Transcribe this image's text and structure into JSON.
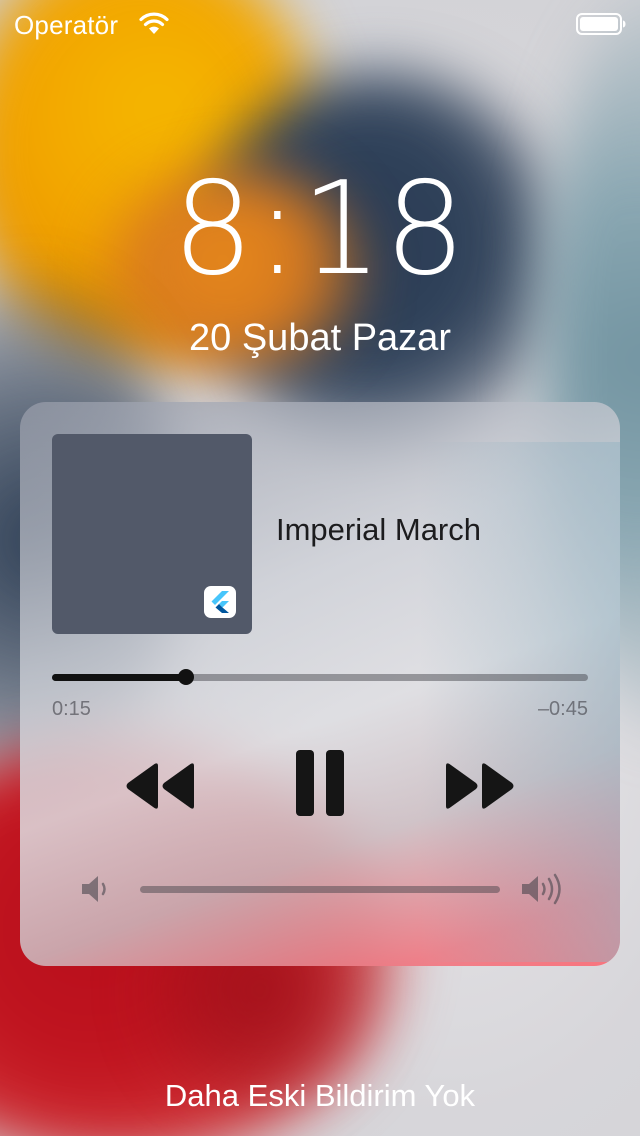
{
  "status_bar": {
    "carrier": "Operatör",
    "wifi_icon": "wifi-icon",
    "battery_icon": "battery-icon"
  },
  "lock_screen": {
    "time": "8:18",
    "date": "20 Şubat Pazar",
    "footer": "Daha Eski Bildirim Yok"
  },
  "now_playing": {
    "title": "Imperial March",
    "app_icon": "flutter-icon",
    "elapsed": "0:15",
    "remaining": "–0:45",
    "progress_fraction": 0.25,
    "volume_fraction": 0.0,
    "controls": {
      "rewind_icon": "rewind-icon",
      "pause_icon": "pause-icon",
      "forward_icon": "fast-forward-icon",
      "volume_low_icon": "volume-low-icon",
      "volume_high_icon": "volume-high-icon"
    },
    "colors": {
      "artwork": "#525969",
      "flutter_light": "#47c5fb",
      "flutter_dark": "#00569e"
    }
  }
}
